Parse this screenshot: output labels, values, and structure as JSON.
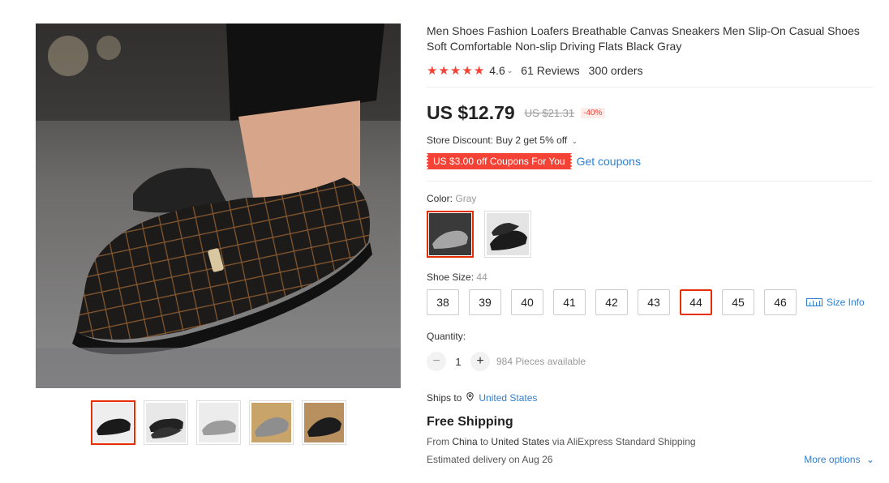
{
  "product": {
    "title": "Men Shoes Fashion Loafers Breathable Canvas Sneakers Men Slip-On Casual Shoes Soft Comfortable Non-slip Driving Flats Black Gray",
    "rating": "4.6",
    "reviews": "61 Reviews",
    "orders": "300 orders",
    "price": "US $12.79",
    "old_price": "US $21.31",
    "discount": "-40%",
    "store_discount": "Store Discount: Buy 2 get 5% off",
    "coupon_badge": "US $3.00 off Coupons For You",
    "get_coupons": "Get coupons",
    "stars_filled": 5
  },
  "gallery": {
    "main_image": "loafer-photo-dark-plaid",
    "thumbnails": [
      "black-plaid-loafer",
      "black-loafer",
      "gray-loafer",
      "gray-loafer-worn",
      "black-loafer-worn"
    ],
    "selected_index": 0
  },
  "color": {
    "label": "Color:",
    "selected": "Gray",
    "options": [
      "Gray",
      "Black"
    ]
  },
  "size": {
    "label": "Shoe Size:",
    "selected": "44",
    "options": [
      "38",
      "39",
      "40",
      "41",
      "42",
      "43",
      "44",
      "45",
      "46"
    ],
    "size_info": "Size Info"
  },
  "quantity": {
    "label": "Quantity:",
    "value": "1",
    "available": "984 Pieces available",
    "minus": "−",
    "plus": "+"
  },
  "shipping": {
    "ships_to_label": "Ships to",
    "country": "United States",
    "free_shipping": "Free Shipping",
    "from_prefix": "From",
    "from_country": "China",
    "to_word": "to",
    "to_country": "United States",
    "via": "via AliExpress Standard Shipping",
    "estimated": "Estimated delivery on Aug 26",
    "more_options": "More options"
  },
  "colors": {
    "accent": "#e62e04",
    "link": "#2e7fd2",
    "star": "#f44336"
  }
}
